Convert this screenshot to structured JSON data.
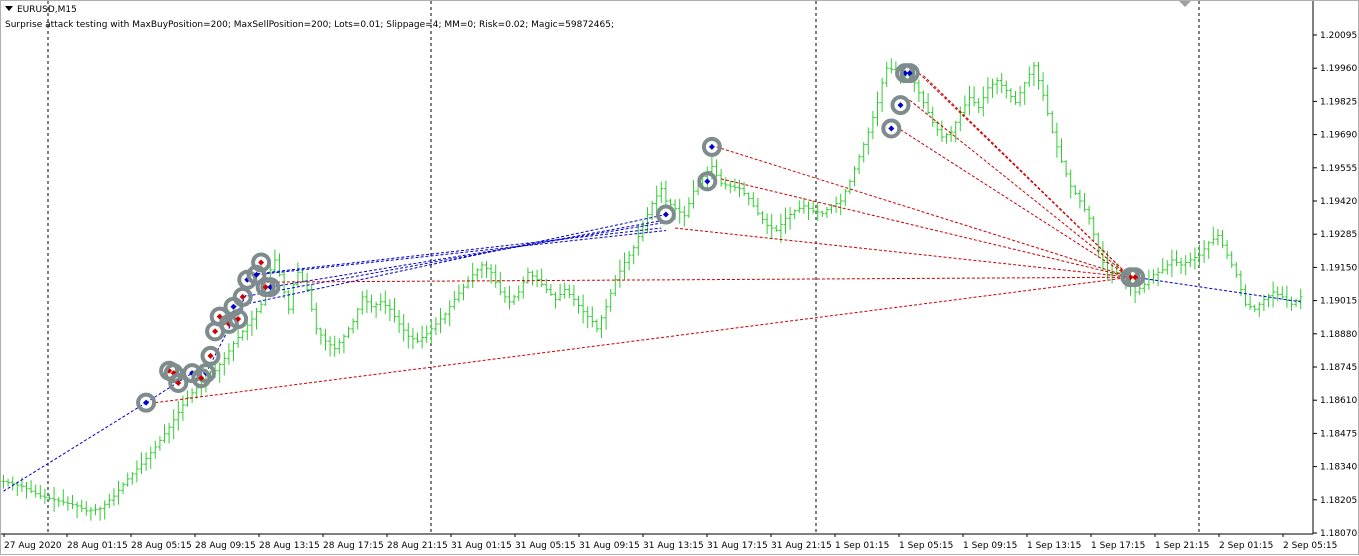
{
  "window": {
    "symbol": "EURUSD,M15",
    "params": "Surprise attack testing with MaxBuyPosition=200; MaxSellPosition=200; Lots=0.01; Slippage=4; MM=0; Risk=0.02; Magic=59872465;"
  },
  "colors": {
    "background": "#ffffff",
    "bars": "#32cd32",
    "buy_line": "#0000cd",
    "sell_line": "#cd0000",
    "marker_ring": "#7f8c8d",
    "separator": "#000000"
  },
  "chart_data": {
    "type": "ohlc",
    "symbol": "EURUSD",
    "timeframe": "M15",
    "y_ticks": [
      "1.20095",
      "1.19960",
      "1.19825",
      "1.19690",
      "1.19555",
      "1.19420",
      "1.19285",
      "1.19150",
      "1.19015",
      "1.18880",
      "1.18745",
      "1.18610",
      "1.18475",
      "1.18340",
      "1.18205",
      "1.18070"
    ],
    "ylim": [
      1.1807,
      1.20095
    ],
    "x_ticks": [
      "27 Aug 2020",
      "28 Aug 01:15",
      "28 Aug 05:15",
      "28 Aug 09:15",
      "28 Aug 13:15",
      "28 Aug 17:15",
      "28 Aug 21:15",
      "31 Aug 01:15",
      "31 Aug 05:15",
      "31 Aug 09:15",
      "31 Aug 13:15",
      "31 Aug 17:15",
      "31 Aug 21:15",
      "1 Sep 01:15",
      "1 Sep 05:15",
      "1 Sep 09:15",
      "1 Sep 13:15",
      "1 Sep 17:15",
      "1 Sep 21:15",
      "2 Sep 01:15",
      "2 Sep 05:15"
    ],
    "close_path": [
      [
        0,
        1.1828
      ],
      [
        4,
        1.1826
      ],
      [
        8,
        1.1822
      ],
      [
        12,
        1.182
      ],
      [
        16,
        1.1818
      ],
      [
        18,
        1.1816
      ],
      [
        21,
        1.1817
      ],
      [
        24,
        1.1822
      ],
      [
        27,
        1.1829
      ],
      [
        30,
        1.1835
      ],
      [
        33,
        1.1842
      ],
      [
        36,
        1.185
      ],
      [
        38,
        1.1856
      ],
      [
        40,
        1.1862
      ],
      [
        42,
        1.1866
      ],
      [
        44,
        1.1872
      ],
      [
        46,
        1.1873
      ],
      [
        48,
        1.1878
      ],
      [
        50,
        1.1884
      ],
      [
        52,
        1.1889
      ],
      [
        54,
        1.1894
      ],
      [
        56,
        1.19
      ],
      [
        57,
        1.1907
      ],
      [
        58,
        1.1914
      ],
      [
        59,
        1.1918
      ],
      [
        60,
        1.1912
      ],
      [
        62,
        1.1898
      ],
      [
        63,
        1.1908
      ],
      [
        64,
        1.1913
      ],
      [
        66,
        1.1906
      ],
      [
        68,
        1.189
      ],
      [
        70,
        1.1885
      ],
      [
        72,
        1.1882
      ],
      [
        74,
        1.1887
      ],
      [
        76,
        1.1893
      ],
      [
        78,
        1.1903
      ],
      [
        80,
        1.1899
      ],
      [
        82,
        1.1901
      ],
      [
        84,
        1.1898
      ],
      [
        86,
        1.1892
      ],
      [
        88,
        1.1887
      ],
      [
        90,
        1.1885
      ],
      [
        92,
        1.1888
      ],
      [
        94,
        1.1892
      ],
      [
        96,
        1.1896
      ],
      [
        98,
        1.1902
      ],
      [
        100,
        1.1907
      ],
      [
        102,
        1.1912
      ],
      [
        104,
        1.1916
      ],
      [
        106,
        1.1913
      ],
      [
        108,
        1.1905
      ],
      [
        110,
        1.1901
      ],
      [
        112,
        1.1905
      ],
      [
        114,
        1.1913
      ],
      [
        116,
        1.191
      ],
      [
        118,
        1.1906
      ],
      [
        120,
        1.1902
      ],
      [
        122,
        1.1906
      ],
      [
        124,
        1.1902
      ],
      [
        126,
        1.1897
      ],
      [
        128,
        1.1893
      ],
      [
        129,
        1.189
      ],
      [
        131,
        1.1899
      ],
      [
        133,
        1.191
      ],
      [
        135,
        1.1917
      ],
      [
        137,
        1.1923
      ],
      [
        139,
        1.1932
      ],
      [
        141,
        1.1941
      ],
      [
        143,
        1.1947
      ],
      [
        144,
        1.1942
      ],
      [
        146,
        1.1939
      ],
      [
        148,
        1.1936
      ],
      [
        150,
        1.1946
      ],
      [
        152,
        1.1952
      ],
      [
        154,
        1.1956
      ],
      [
        156,
        1.1949
      ],
      [
        158,
        1.1948
      ],
      [
        160,
        1.1947
      ],
      [
        162,
        1.1943
      ],
      [
        164,
        1.1937
      ],
      [
        166,
        1.1932
      ],
      [
        168,
        1.193
      ],
      [
        170,
        1.1935
      ],
      [
        172,
        1.1938
      ],
      [
        174,
        1.194
      ],
      [
        176,
        1.1938
      ],
      [
        178,
        1.1937
      ],
      [
        180,
        1.194
      ],
      [
        182,
        1.1942
      ],
      [
        184,
        1.195
      ],
      [
        186,
        1.196
      ],
      [
        188,
        1.197
      ],
      [
        190,
        1.1982
      ],
      [
        191,
        1.199
      ],
      [
        192,
        1.1996
      ],
      [
        194,
        1.1995
      ],
      [
        196,
        1.1993
      ],
      [
        198,
        1.199
      ],
      [
        200,
        1.1982
      ],
      [
        202,
        1.1974
      ],
      [
        204,
        1.1968
      ],
      [
        206,
        1.197
      ],
      [
        208,
        1.1978
      ],
      [
        210,
        1.1984
      ],
      [
        212,
        1.198
      ],
      [
        214,
        1.1988
      ],
      [
        216,
        1.1991
      ],
      [
        218,
        1.1987
      ],
      [
        220,
        1.1982
      ],
      [
        222,
        1.199
      ],
      [
        224,
        1.1997
      ],
      [
        226,
        1.1985
      ],
      [
        228,
        1.197
      ],
      [
        230,
        1.1958
      ],
      [
        232,
        1.1948
      ],
      [
        234,
        1.1942
      ],
      [
        236,
        1.1935
      ],
      [
        238,
        1.1922
      ],
      [
        240,
        1.1912
      ],
      [
        242,
        1.1913
      ],
      [
        244,
        1.191
      ],
      [
        246,
        1.1905
      ],
      [
        248,
        1.1908
      ],
      [
        250,
        1.1912
      ],
      [
        252,
        1.1914
      ],
      [
        254,
        1.1918
      ],
      [
        256,
        1.1916
      ],
      [
        258,
        1.1918
      ],
      [
        260,
        1.192
      ],
      [
        262,
        1.1925
      ],
      [
        264,
        1.1928
      ],
      [
        266,
        1.192
      ],
      [
        268,
        1.1912
      ],
      [
        270,
        1.19
      ],
      [
        272,
        1.1898
      ],
      [
        274,
        1.1902
      ],
      [
        276,
        1.1905
      ],
      [
        278,
        1.1903
      ],
      [
        280,
        1.19
      ],
      [
        282,
        1.1903
      ]
    ],
    "buy_markers": [
      [
        31,
        1.186
      ],
      [
        144,
        1.19365
      ],
      [
        153,
        1.195
      ],
      [
        154,
        1.1964
      ],
      [
        193,
        1.19715
      ],
      [
        195,
        1.1981
      ],
      [
        196,
        1.1994
      ],
      [
        197,
        1.1994
      ],
      [
        41,
        1.1872
      ],
      [
        44,
        1.1872
      ],
      [
        50,
        1.1899
      ],
      [
        53,
        1.191
      ],
      [
        55,
        1.1912
      ],
      [
        58,
        1.1907
      ]
    ],
    "sell_markers": [
      [
        36,
        1.1873
      ],
      [
        37,
        1.1872
      ],
      [
        38,
        1.1868
      ],
      [
        43,
        1.187
      ],
      [
        45,
        1.1879
      ],
      [
        46,
        1.1889
      ],
      [
        47,
        1.1895
      ],
      [
        49,
        1.1892
      ],
      [
        51,
        1.1894
      ],
      [
        52,
        1.1903
      ],
      [
        56,
        1.1917
      ],
      [
        57,
        1.1907
      ],
      [
        245,
        1.1911
      ],
      [
        246,
        1.1911
      ]
    ],
    "buy_lines": [
      [
        [
          0,
          1.1824
        ],
        [
          31,
          1.186
        ]
      ],
      [
        [
          31,
          1.186
        ],
        [
          41,
          1.1872
        ]
      ],
      [
        [
          44,
          1.1872
        ],
        [
          55,
          1.1912
        ]
      ],
      [
        [
          50,
          1.1899
        ],
        [
          144,
          1.19365
        ]
      ],
      [
        [
          52,
          1.1903
        ],
        [
          143,
          1.1934
        ]
      ],
      [
        [
          53,
          1.1912
        ],
        [
          143,
          1.1931
        ]
      ],
      [
        [
          55,
          1.1912
        ],
        [
          144,
          1.193
        ]
      ],
      [
        [
          58,
          1.1907
        ],
        [
          143,
          1.1933
        ]
      ],
      [
        [
          246,
          1.1911
        ],
        [
          282,
          1.1901
        ]
      ]
    ],
    "sell_lines": [
      [
        [
          33,
          1.186
        ],
        [
          245,
          1.1911
        ]
      ],
      [
        [
          54,
          1.1909
        ],
        [
          245,
          1.1911
        ]
      ],
      [
        [
          146,
          1.1931
        ],
        [
          245,
          1.1911
        ]
      ],
      [
        [
          156,
          1.1951
        ],
        [
          245,
          1.1911
        ]
      ],
      [
        [
          155,
          1.1964
        ],
        [
          245,
          1.1911
        ]
      ],
      [
        [
          195,
          1.1971
        ],
        [
          245,
          1.1911
        ]
      ],
      [
        [
          197,
          1.1983
        ],
        [
          245,
          1.1911
        ]
      ],
      [
        [
          199,
          1.1994
        ],
        [
          245,
          1.1911
        ]
      ],
      [
        [
          200,
          1.1993
        ],
        [
          245,
          1.1911
        ]
      ]
    ],
    "grid": false,
    "day_separators": [
      "28 Aug",
      "31 Aug",
      "1 Sep",
      "2 Sep"
    ]
  }
}
